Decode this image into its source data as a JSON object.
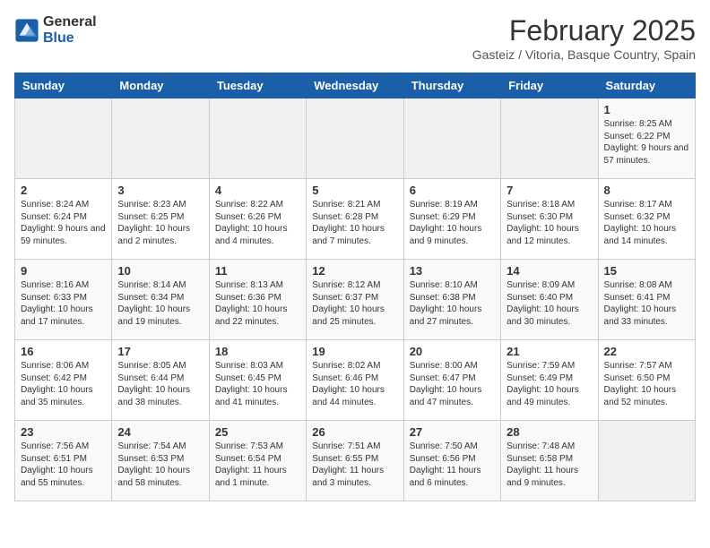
{
  "header": {
    "logo_general": "General",
    "logo_blue": "Blue",
    "month_title": "February 2025",
    "location": "Gasteiz / Vitoria, Basque Country, Spain"
  },
  "days_of_week": [
    "Sunday",
    "Monday",
    "Tuesday",
    "Wednesday",
    "Thursday",
    "Friday",
    "Saturday"
  ],
  "weeks": [
    [
      {
        "date": "",
        "content": ""
      },
      {
        "date": "",
        "content": ""
      },
      {
        "date": "",
        "content": ""
      },
      {
        "date": "",
        "content": ""
      },
      {
        "date": "",
        "content": ""
      },
      {
        "date": "",
        "content": ""
      },
      {
        "date": "1",
        "content": "Sunrise: 8:25 AM\nSunset: 6:22 PM\nDaylight: 9 hours and 57 minutes."
      }
    ],
    [
      {
        "date": "2",
        "content": "Sunrise: 8:24 AM\nSunset: 6:24 PM\nDaylight: 9 hours and 59 minutes."
      },
      {
        "date": "3",
        "content": "Sunrise: 8:23 AM\nSunset: 6:25 PM\nDaylight: 10 hours and 2 minutes."
      },
      {
        "date": "4",
        "content": "Sunrise: 8:22 AM\nSunset: 6:26 PM\nDaylight: 10 hours and 4 minutes."
      },
      {
        "date": "5",
        "content": "Sunrise: 8:21 AM\nSunset: 6:28 PM\nDaylight: 10 hours and 7 minutes."
      },
      {
        "date": "6",
        "content": "Sunrise: 8:19 AM\nSunset: 6:29 PM\nDaylight: 10 hours and 9 minutes."
      },
      {
        "date": "7",
        "content": "Sunrise: 8:18 AM\nSunset: 6:30 PM\nDaylight: 10 hours and 12 minutes."
      },
      {
        "date": "8",
        "content": "Sunrise: 8:17 AM\nSunset: 6:32 PM\nDaylight: 10 hours and 14 minutes."
      }
    ],
    [
      {
        "date": "9",
        "content": "Sunrise: 8:16 AM\nSunset: 6:33 PM\nDaylight: 10 hours and 17 minutes."
      },
      {
        "date": "10",
        "content": "Sunrise: 8:14 AM\nSunset: 6:34 PM\nDaylight: 10 hours and 19 minutes."
      },
      {
        "date": "11",
        "content": "Sunrise: 8:13 AM\nSunset: 6:36 PM\nDaylight: 10 hours and 22 minutes."
      },
      {
        "date": "12",
        "content": "Sunrise: 8:12 AM\nSunset: 6:37 PM\nDaylight: 10 hours and 25 minutes."
      },
      {
        "date": "13",
        "content": "Sunrise: 8:10 AM\nSunset: 6:38 PM\nDaylight: 10 hours and 27 minutes."
      },
      {
        "date": "14",
        "content": "Sunrise: 8:09 AM\nSunset: 6:40 PM\nDaylight: 10 hours and 30 minutes."
      },
      {
        "date": "15",
        "content": "Sunrise: 8:08 AM\nSunset: 6:41 PM\nDaylight: 10 hours and 33 minutes."
      }
    ],
    [
      {
        "date": "16",
        "content": "Sunrise: 8:06 AM\nSunset: 6:42 PM\nDaylight: 10 hours and 35 minutes."
      },
      {
        "date": "17",
        "content": "Sunrise: 8:05 AM\nSunset: 6:44 PM\nDaylight: 10 hours and 38 minutes."
      },
      {
        "date": "18",
        "content": "Sunrise: 8:03 AM\nSunset: 6:45 PM\nDaylight: 10 hours and 41 minutes."
      },
      {
        "date": "19",
        "content": "Sunrise: 8:02 AM\nSunset: 6:46 PM\nDaylight: 10 hours and 44 minutes."
      },
      {
        "date": "20",
        "content": "Sunrise: 8:00 AM\nSunset: 6:47 PM\nDaylight: 10 hours and 47 minutes."
      },
      {
        "date": "21",
        "content": "Sunrise: 7:59 AM\nSunset: 6:49 PM\nDaylight: 10 hours and 49 minutes."
      },
      {
        "date": "22",
        "content": "Sunrise: 7:57 AM\nSunset: 6:50 PM\nDaylight: 10 hours and 52 minutes."
      }
    ],
    [
      {
        "date": "23",
        "content": "Sunrise: 7:56 AM\nSunset: 6:51 PM\nDaylight: 10 hours and 55 minutes."
      },
      {
        "date": "24",
        "content": "Sunrise: 7:54 AM\nSunset: 6:53 PM\nDaylight: 10 hours and 58 minutes."
      },
      {
        "date": "25",
        "content": "Sunrise: 7:53 AM\nSunset: 6:54 PM\nDaylight: 11 hours and 1 minute."
      },
      {
        "date": "26",
        "content": "Sunrise: 7:51 AM\nSunset: 6:55 PM\nDaylight: 11 hours and 3 minutes."
      },
      {
        "date": "27",
        "content": "Sunrise: 7:50 AM\nSunset: 6:56 PM\nDaylight: 11 hours and 6 minutes."
      },
      {
        "date": "28",
        "content": "Sunrise: 7:48 AM\nSunset: 6:58 PM\nDaylight: 11 hours and 9 minutes."
      },
      {
        "date": "",
        "content": ""
      }
    ]
  ]
}
